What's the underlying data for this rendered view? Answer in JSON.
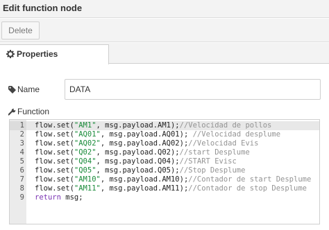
{
  "dialog": {
    "title": "Edit function node",
    "delete_label": "Delete",
    "tab_properties": "Properties"
  },
  "form": {
    "name_label": "Name",
    "name_value": "DATA",
    "function_label": "Function"
  },
  "editor": {
    "lines": [
      {
        "n": "1",
        "parts": [
          [
            "t",
            "flow.set("
          ],
          [
            "s",
            "\"AM1\""
          ],
          [
            "t",
            ", msg.payload.AM1);"
          ],
          [
            "c",
            "//Velocidad de pollos"
          ]
        ]
      },
      {
        "n": "2",
        "parts": [
          [
            "t",
            "flow.set("
          ],
          [
            "s",
            "\"AQ01\""
          ],
          [
            "t",
            ", msg.payload.AQ01); "
          ],
          [
            "c",
            "//Velocidad desplume"
          ]
        ]
      },
      {
        "n": "3",
        "parts": [
          [
            "t",
            "flow.set("
          ],
          [
            "s",
            "\"AQ02\""
          ],
          [
            "t",
            ", msg.payload.AQ02);"
          ],
          [
            "c",
            "//Velocidad Evis"
          ]
        ]
      },
      {
        "n": "4",
        "parts": [
          [
            "t",
            "flow.set("
          ],
          [
            "s",
            "\"Q02\""
          ],
          [
            "t",
            ", msg.payload.Q02);"
          ],
          [
            "c",
            "//start Desplume"
          ]
        ]
      },
      {
        "n": "5",
        "parts": [
          [
            "t",
            "flow.set("
          ],
          [
            "s",
            "\"Q04\""
          ],
          [
            "t",
            ", msg.payload.Q04);"
          ],
          [
            "c",
            "//START Evisc"
          ]
        ]
      },
      {
        "n": "6",
        "parts": [
          [
            "t",
            "flow.set("
          ],
          [
            "s",
            "\"Q05\""
          ],
          [
            "t",
            ", msg.payload.Q05);"
          ],
          [
            "c",
            "//Stop Desplume"
          ]
        ]
      },
      {
        "n": "7",
        "parts": [
          [
            "t",
            "flow.set("
          ],
          [
            "s",
            "\"AM10\""
          ],
          [
            "t",
            ", msg.payload.AM10);"
          ],
          [
            "c",
            "//Contador de start Desplume"
          ]
        ]
      },
      {
        "n": "8",
        "parts": [
          [
            "t",
            "flow.set("
          ],
          [
            "s",
            "\"AM11\""
          ],
          [
            "t",
            ", msg.payload.AM11);"
          ],
          [
            "c",
            "//Contador de stop Desplume"
          ]
        ]
      },
      {
        "n": "9",
        "parts": [
          [
            "k",
            "return"
          ],
          [
            "t",
            " msg;"
          ]
        ]
      }
    ]
  },
  "icons": {
    "tab": "gear-icon",
    "name": "tag-icon",
    "function": "wrench-icon"
  }
}
